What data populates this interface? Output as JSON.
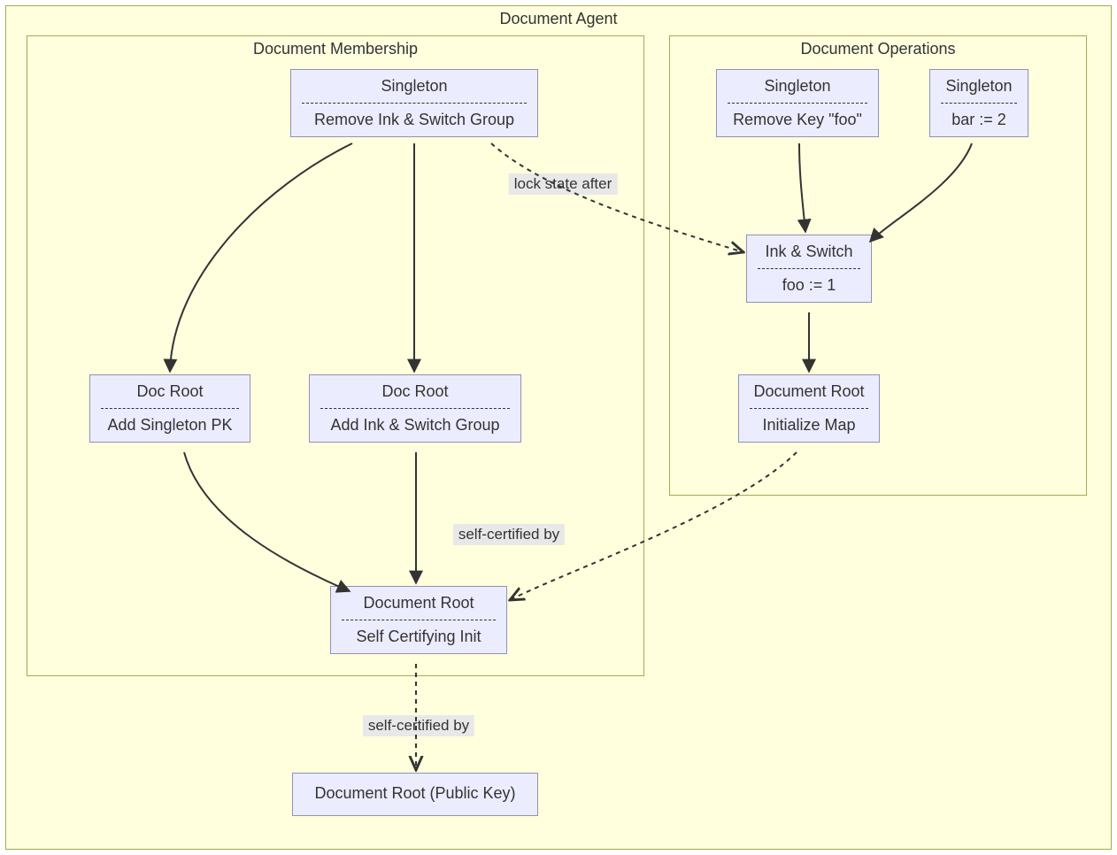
{
  "diagram": {
    "outer": {
      "title": "Document Agent"
    },
    "membership": {
      "title": "Document Membership"
    },
    "operations": {
      "title": "Document Operations"
    },
    "nodes": {
      "m_singleton": {
        "title": "Singleton",
        "sub": "Remove Ink & Switch Group"
      },
      "m_docroot_left": {
        "title": "Doc Root",
        "sub": "Add Singleton PK"
      },
      "m_docroot_right": {
        "title": "Doc Root",
        "sub": "Add Ink & Switch Group"
      },
      "m_selfcert": {
        "title": "Document Root",
        "sub": "Self Certifying Init"
      },
      "o_singleton_left": {
        "title": "Singleton",
        "sub": "Remove Key \"foo\""
      },
      "o_singleton_right": {
        "title": "Singleton",
        "sub": "bar := 2"
      },
      "o_inkswitch": {
        "title": "Ink & Switch",
        "sub": "foo := 1"
      },
      "o_docroot": {
        "title": "Document Root",
        "sub": "Initialize Map"
      },
      "pubkey": {
        "title": "Document Root (Public Key)"
      }
    },
    "edge_labels": {
      "lock_state_after": "lock state after",
      "self_cert_by_1": "self-certified by",
      "self_cert_by_2": "self-certified by"
    }
  }
}
